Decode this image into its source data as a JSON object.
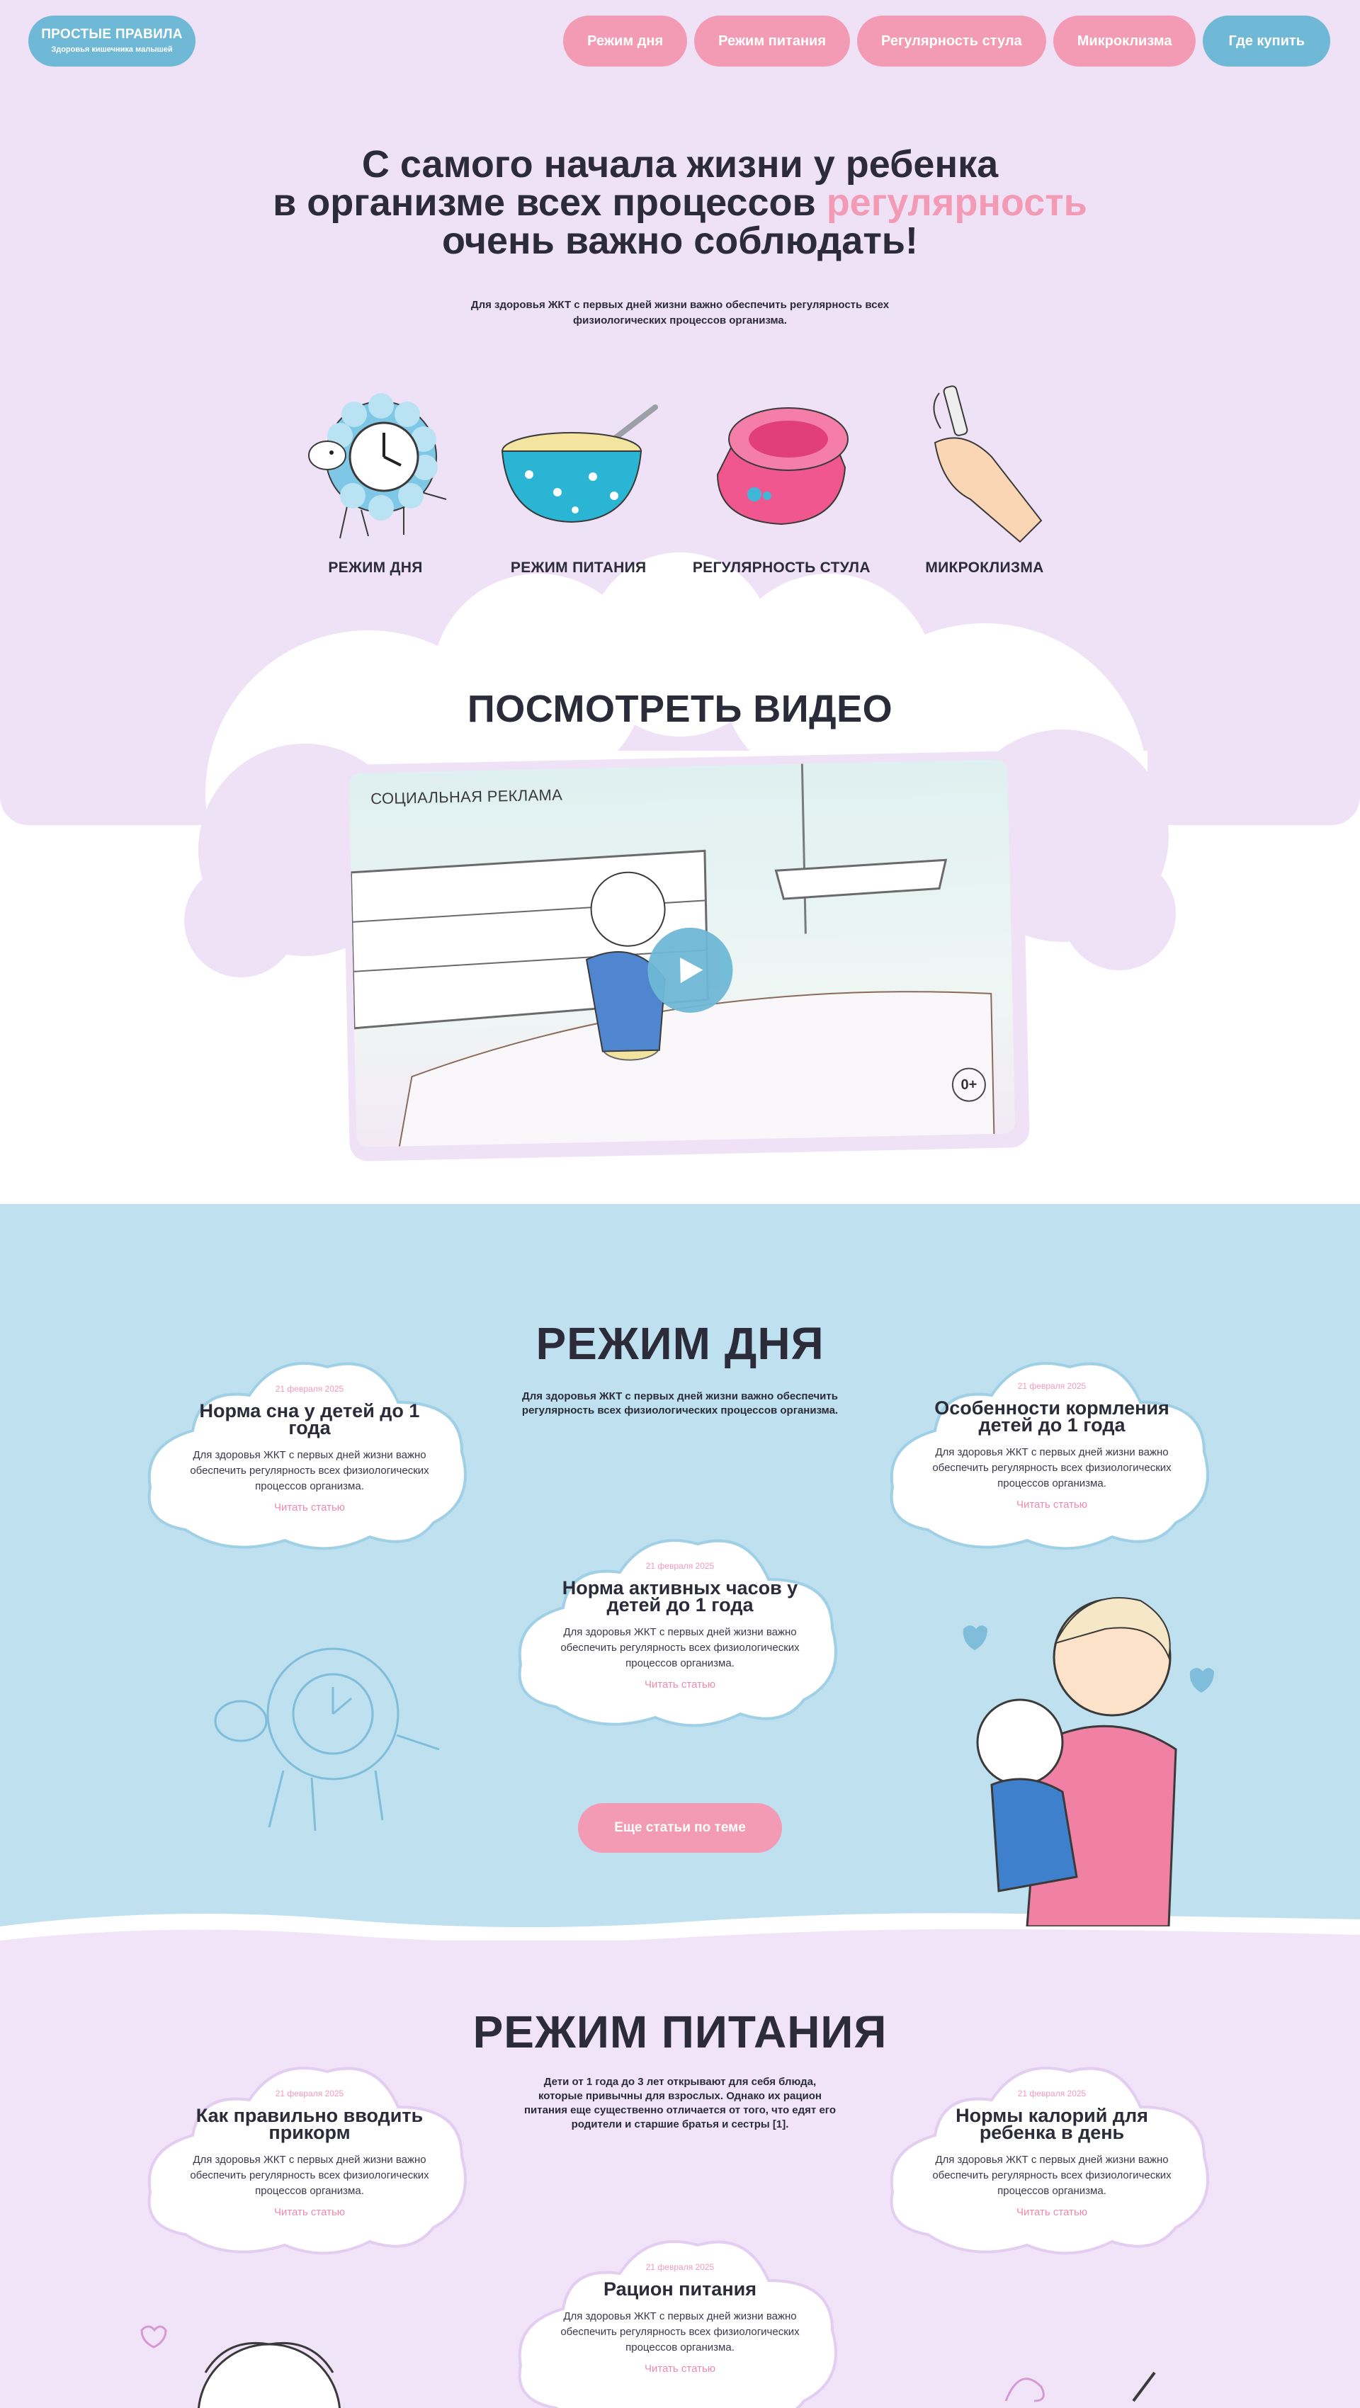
{
  "colors": {
    "pink": "#f39bb4",
    "blue": "#6fb8d6",
    "lilac": "#efe2f7",
    "sky": "#bee0ef",
    "text": "#2b2b3a"
  },
  "header": {
    "logo_title": "ПРОСТЫЕ ПРАВИЛА",
    "logo_subtitle": "Здоровья кишечника малышей",
    "nav": [
      "Режим дня",
      "Режим питания",
      "Регулярность стула",
      "Микроклизма",
      "Где купить"
    ]
  },
  "hero": {
    "line1": "С самого начала жизни у ребенка",
    "line2a": "в организме всех процессов",
    "line2b": "регулярность",
    "line3": "очень важно соблюдать!",
    "subtitle": "Для здоровья ЖКТ с первых дней жизни важно обеспечить регулярность всех физиологических процессов организма.",
    "features": [
      {
        "label": "РЕЖИМ ДНЯ",
        "icon": "clock-sheep-icon"
      },
      {
        "label": "РЕЖИМ ПИТАНИЯ",
        "icon": "bowl-icon"
      },
      {
        "label": "РЕГУЛЯРНОСТЬ СТУЛА",
        "icon": "potty-icon"
      },
      {
        "label": "МИКРОКЛИЗМА",
        "icon": "hand-microenema-icon"
      }
    ]
  },
  "video": {
    "title": "ПОСМОТРЕТЬ ВИДЕО",
    "caption": "СОЦИАЛЬНАЯ РЕКЛАМА",
    "age": "0+"
  },
  "day_regime": {
    "title": "РЕЖИМ ДНЯ",
    "subtitle": "Для здоровья ЖКТ с первых дней жизни важно обеспечить регулярность всех физиологических процессов организма.",
    "articles": [
      {
        "date": "21 февраля 2025",
        "title": "Норма сна у детей до 1 года",
        "text": "Для здоровья ЖКТ с первых дней жизни важно обеспечить регулярность всех физиологических процессов организма.",
        "link": "Читать статью"
      },
      {
        "date": "21 февраля 2025",
        "title": "Особенности кормления детей до 1 года",
        "text": "Для здоровья ЖКТ с первых дней жизни важно обеспечить регулярность всех физиологических процессов организма.",
        "link": "Читать статью"
      },
      {
        "date": "21 февраля 2025",
        "title": "Норма активных часов у детей до 1 года",
        "text": "Для здоровья ЖКТ с первых дней жизни важно обеспечить регулярность всех физиологических процессов организма.",
        "link": "Читать статью"
      }
    ],
    "more_button": "Еще статьи по теме"
  },
  "nutrition": {
    "title": "РЕЖИМ ПИТАНИЯ",
    "subtitle": "Дети от 1 года до 3 лет открывают для себя блюда, которые привычны для взрослых. Однако их рацион питания еще существенно отличается от того, что едят его родители и старшие братья и сестры [1].",
    "articles": [
      {
        "date": "21 февраля 2025",
        "title": "Как правильно вводить прикорм",
        "text": "Для здоровья ЖКТ с первых дней жизни важно обеспечить регулярность всех физиологических процессов организма.",
        "link": "Читать статью"
      },
      {
        "date": "21 февраля 2025",
        "title": "Нормы калорий для ребенка в день",
        "text": "Для здоровья ЖКТ с первых дней жизни важно обеспечить регулярность всех физиологических процессов организма.",
        "link": "Читать статью"
      },
      {
        "date": "21 февраля 2025",
        "title": "Рацион питания",
        "text": "Для здоровья ЖКТ с первых дней жизни важно обеспечить регулярность всех физиологических процессов организма.",
        "link": "Читать статью"
      }
    ]
  }
}
